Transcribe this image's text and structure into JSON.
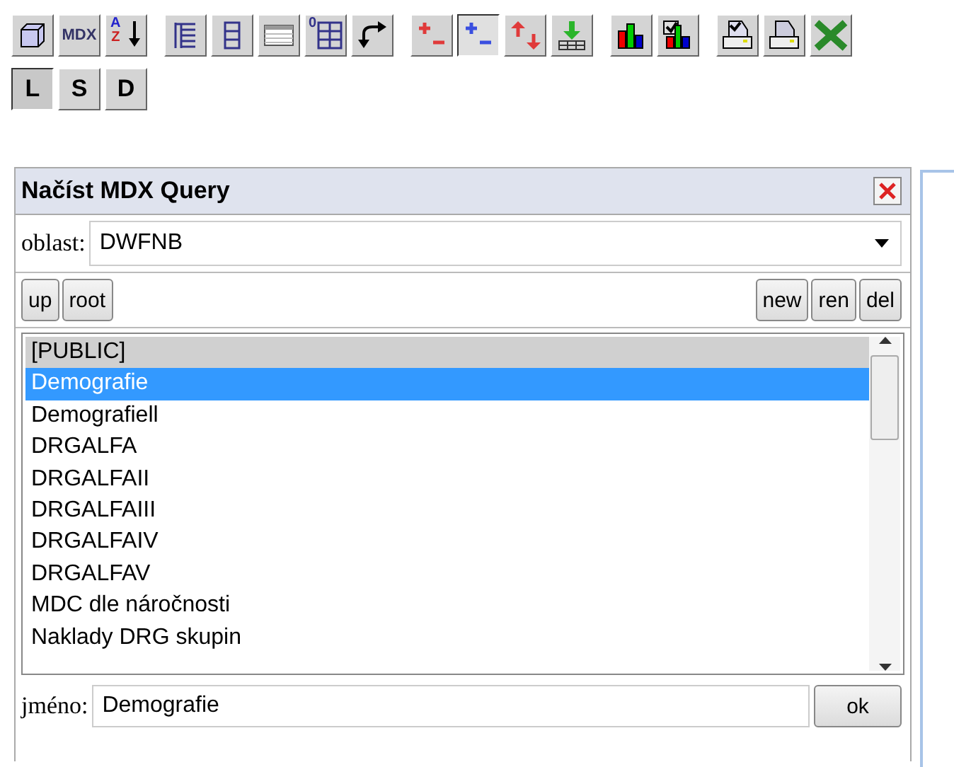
{
  "toolbar_groups": [
    [
      {
        "kind": "cube",
        "pressed": false
      },
      {
        "kind": "text",
        "label": "MDX",
        "pressed": false
      },
      {
        "kind": "sort",
        "letters": [
          "A",
          "Z"
        ],
        "pressed": false
      }
    ],
    [
      {
        "kind": "tree",
        "pressed": false
      },
      {
        "kind": "columns",
        "pressed": false
      },
      {
        "kind": "table",
        "pressed": false
      },
      {
        "kind": "zero-grid",
        "label": "0",
        "pressed": false
      },
      {
        "kind": "swap",
        "pressed": false
      }
    ],
    [
      {
        "kind": "plusminus-red",
        "pressed": false
      },
      {
        "kind": "plusminus-blue",
        "pressed": true
      },
      {
        "kind": "updown",
        "pressed": false
      },
      {
        "kind": "download",
        "pressed": false
      }
    ],
    [
      {
        "kind": "bars",
        "pressed": false
      },
      {
        "kind": "bars-check",
        "pressed": false
      }
    ],
    [
      {
        "kind": "print-check",
        "pressed": false
      },
      {
        "kind": "print",
        "pressed": false
      },
      {
        "kind": "excel",
        "pressed": false
      }
    ]
  ],
  "modes": [
    {
      "label": "L",
      "selected": true
    },
    {
      "label": "S",
      "selected": false
    },
    {
      "label": "D",
      "selected": false
    }
  ],
  "dialog": {
    "title": "Načíst MDX Query",
    "area": {
      "label": "oblast:",
      "value": "DWFNB"
    },
    "nav_buttons": [
      "up",
      "root"
    ],
    "action_buttons": [
      "new",
      "ren",
      "del"
    ],
    "items": [
      {
        "label": "[PUBLIC]",
        "kind": "folder",
        "selected": false
      },
      {
        "label": "Demografie",
        "kind": "query",
        "selected": true
      },
      {
        "label": "Demografiell",
        "kind": "query",
        "selected": false
      },
      {
        "label": "DRGALFA",
        "kind": "query",
        "selected": false
      },
      {
        "label": "DRGALFAII",
        "kind": "query",
        "selected": false
      },
      {
        "label": "DRGALFAIII",
        "kind": "query",
        "selected": false
      },
      {
        "label": "DRGALFAIV",
        "kind": "query",
        "selected": false
      },
      {
        "label": "DRGALFAV",
        "kind": "query",
        "selected": false
      },
      {
        "label": "MDC dle náročnosti",
        "kind": "query",
        "selected": false
      },
      {
        "label": "Naklady DRG skupin",
        "kind": "query",
        "selected": false
      }
    ],
    "name": {
      "label": "jméno:",
      "value": "Demografie"
    },
    "ok": "ok"
  }
}
